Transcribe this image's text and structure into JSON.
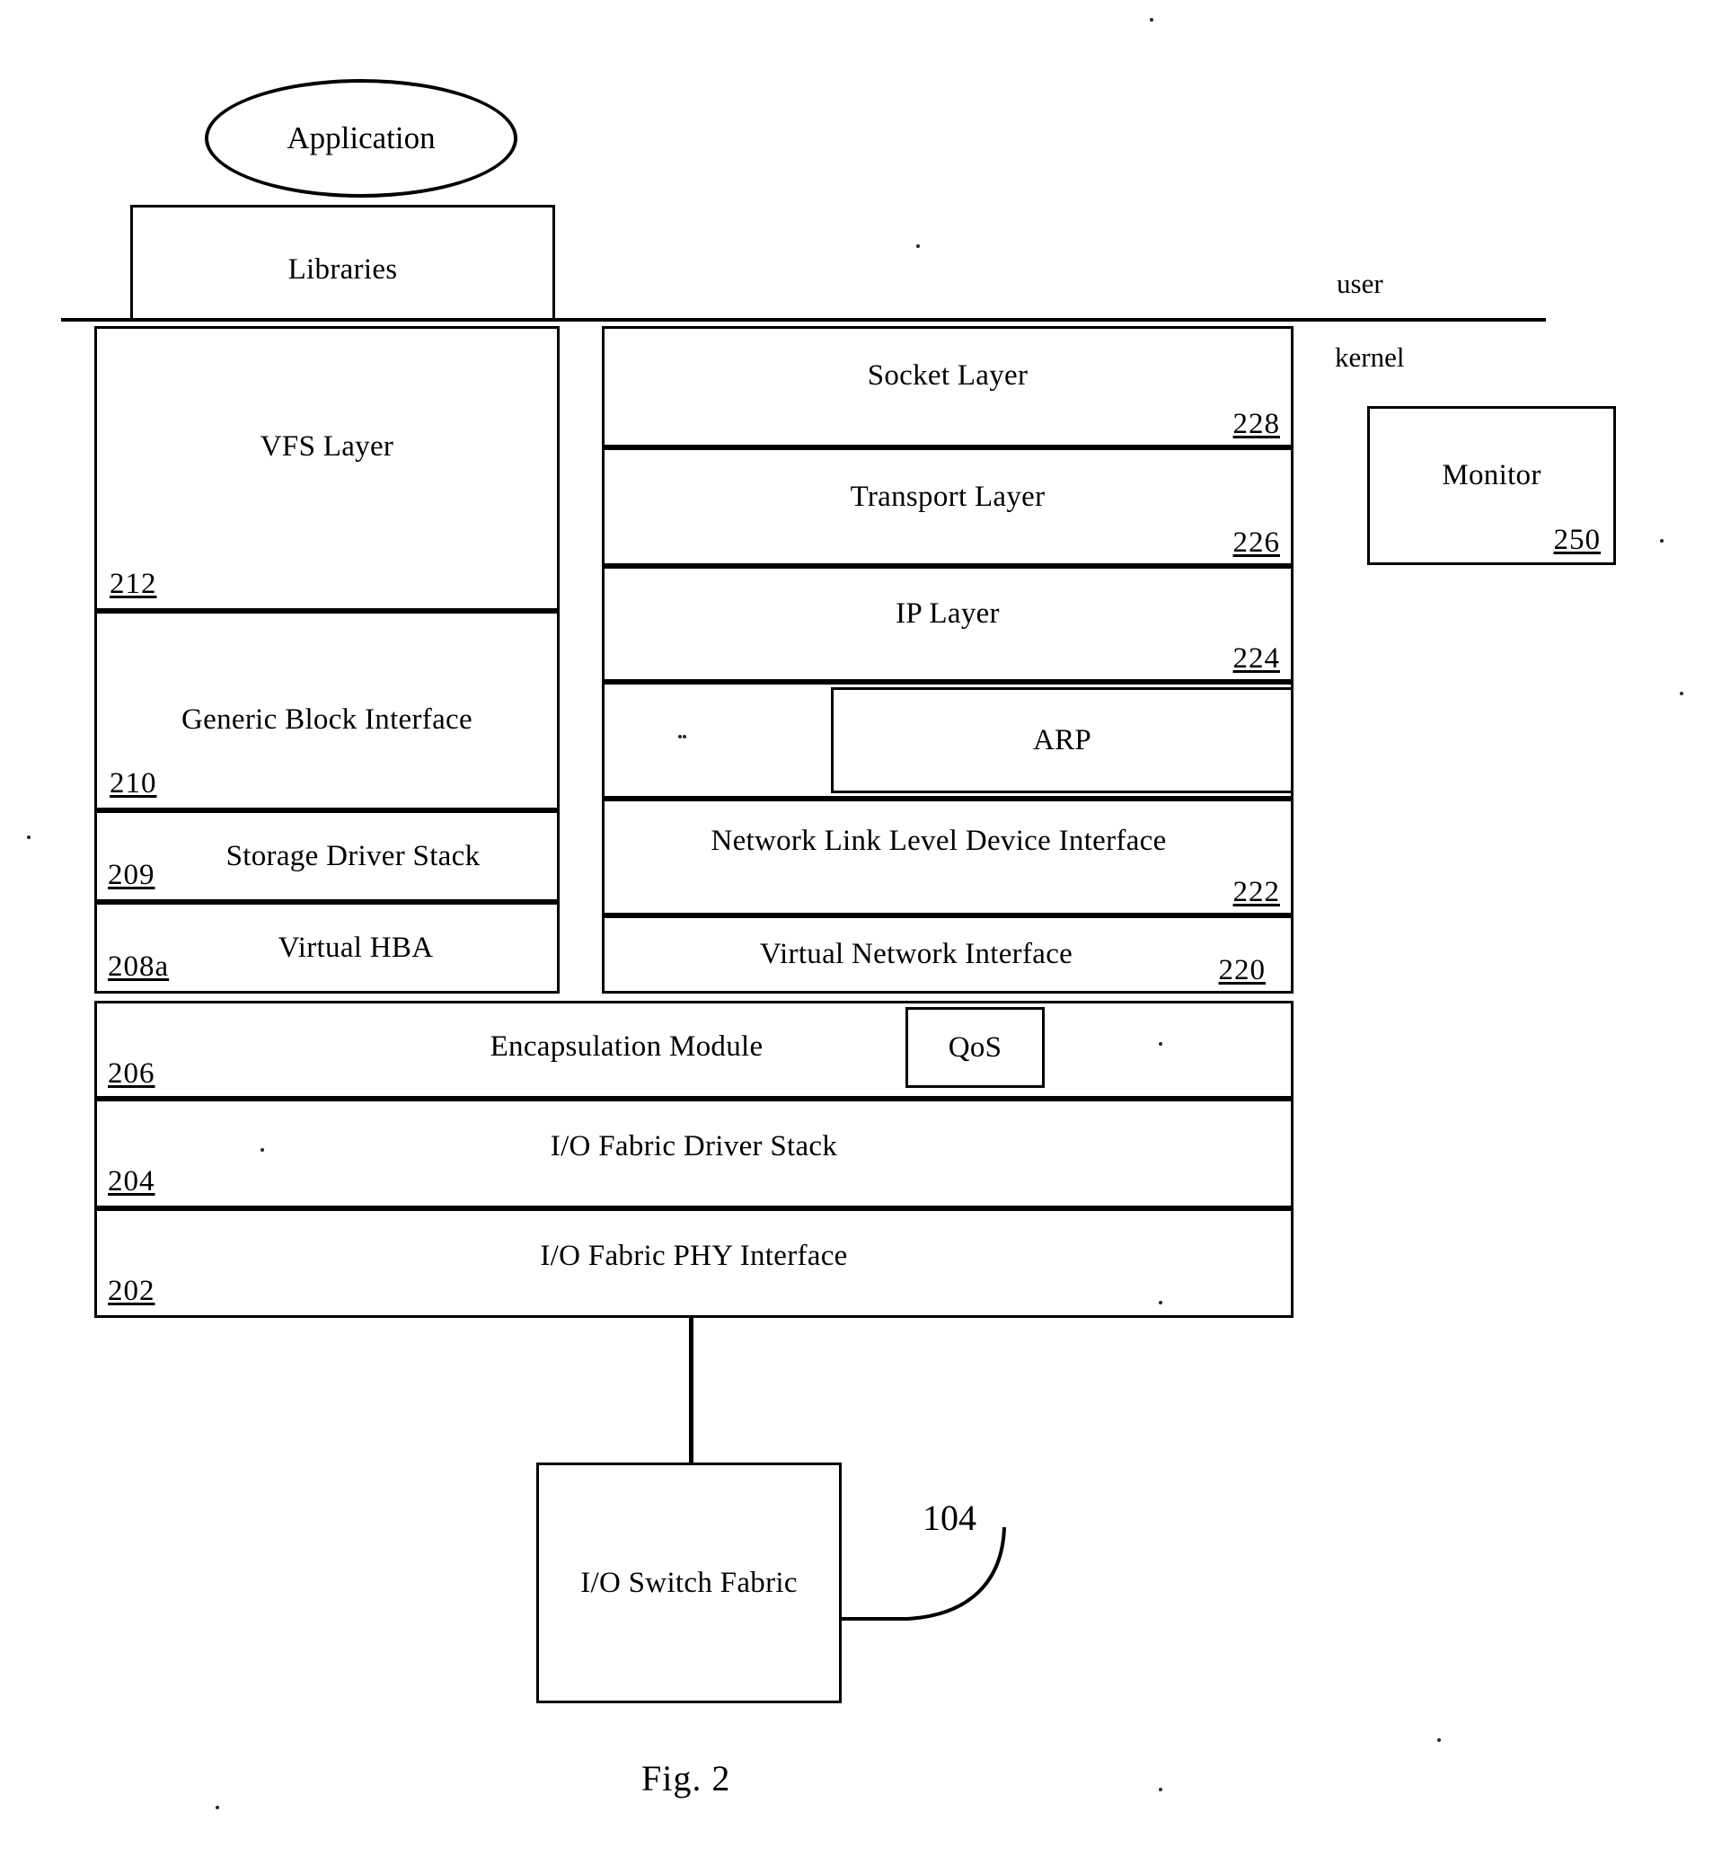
{
  "figure": {
    "caption": "Fig. 2"
  },
  "zones": {
    "user_label": "user",
    "kernel_label": "kernel"
  },
  "application": {
    "label": "Application"
  },
  "libraries": {
    "label": "Libraries"
  },
  "storage_stack": [
    {
      "label": "VFS Layer",
      "num": "212"
    },
    {
      "label": "Generic Block Interface",
      "num": "210"
    },
    {
      "label": "Storage Driver Stack",
      "num": "209"
    },
    {
      "label": "Virtual HBA",
      "num": "208a"
    }
  ],
  "network_stack": [
    {
      "label": "Socket Layer",
      "num": "228"
    },
    {
      "label": "Transport Layer",
      "num": "226"
    },
    {
      "label": "IP Layer",
      "num": "224"
    },
    {
      "label": "ARP",
      "num": ""
    },
    {
      "label": "Network Link Level Device Interface",
      "num": "222"
    },
    {
      "label": "Virtual Network Interface",
      "num": "220"
    }
  ],
  "common_stack": [
    {
      "label": "Encapsulation Module",
      "num": "206"
    },
    {
      "label": "I/O Fabric Driver Stack",
      "num": "204"
    },
    {
      "label": "I/O Fabric PHY Interface",
      "num": "202"
    }
  ],
  "qos": {
    "label": "QoS"
  },
  "monitor": {
    "label": "Monitor",
    "num": "250"
  },
  "switch_fabric": {
    "label": "I/O Switch Fabric",
    "num": "104"
  }
}
